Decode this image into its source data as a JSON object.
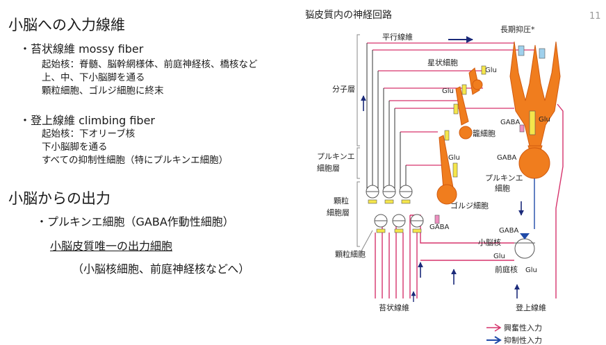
{
  "page_number": "11",
  "left": {
    "input_title": "小脳への入力線維",
    "mossy": {
      "bullet": "・苔状線維 mossy fiber",
      "lines": [
        "起始核：脊髄、脳幹網様体、前庭神経核、橋核など",
        "上、中、下小脳脚を通る",
        "顆粒細胞、ゴルジ細胞に終末"
      ]
    },
    "climbing": {
      "bullet": "・登上線維 climbing fiber",
      "lines": [
        "起始核：下オリーブ核",
        "下小脳脚を通る",
        "すべての抑制性細胞（特にプルキンエ細胞）"
      ]
    },
    "output_title": "小脳からの出力",
    "purkinje_bullet": "・プルキンエ細胞（GABA作動性細胞）",
    "only_output": "小脳皮質唯一の出力細胞",
    "targets": "（小脳核細胞、前庭神経核などへ）"
  },
  "diagram": {
    "title": "小脳皮質内の神経回路",
    "layers": {
      "molecular": "分子層",
      "purkinje_1": "プルキンエ",
      "purkinje_2": "細胞層",
      "granular_1": "顆粒",
      "granular_2": "細胞層"
    },
    "labels": {
      "parallel_fiber": "平行線維",
      "ltd": "長期抑圧*",
      "stellate": "星状細胞",
      "basket": "籠細胞",
      "golgi": "ゴルジ細胞",
      "purkinje_1": "プルキンエ",
      "purkinje_2": "細胞",
      "granule": "顆粒細胞",
      "mossy": "苔状線維",
      "climbing": "登上線維",
      "cerebellar_nucleus": "小脳核",
      "vestibular_nucleus": "前庭核"
    },
    "transmitters": {
      "glu": "Glu",
      "gaba": "GABA"
    },
    "legend": {
      "excitatory": "興奮性入力",
      "inhibitory": "抑制性入力"
    },
    "colors": {
      "cell_fill": "#f07d1e",
      "cell_stroke": "#d05a10",
      "fiber": "#d6336c",
      "inhibitory": "#1f4aa8",
      "synapse_yellow": "#f5e64b",
      "synapse_pink": "#ee8fc0",
      "synapse_blue": "#9fd0ec"
    }
  }
}
